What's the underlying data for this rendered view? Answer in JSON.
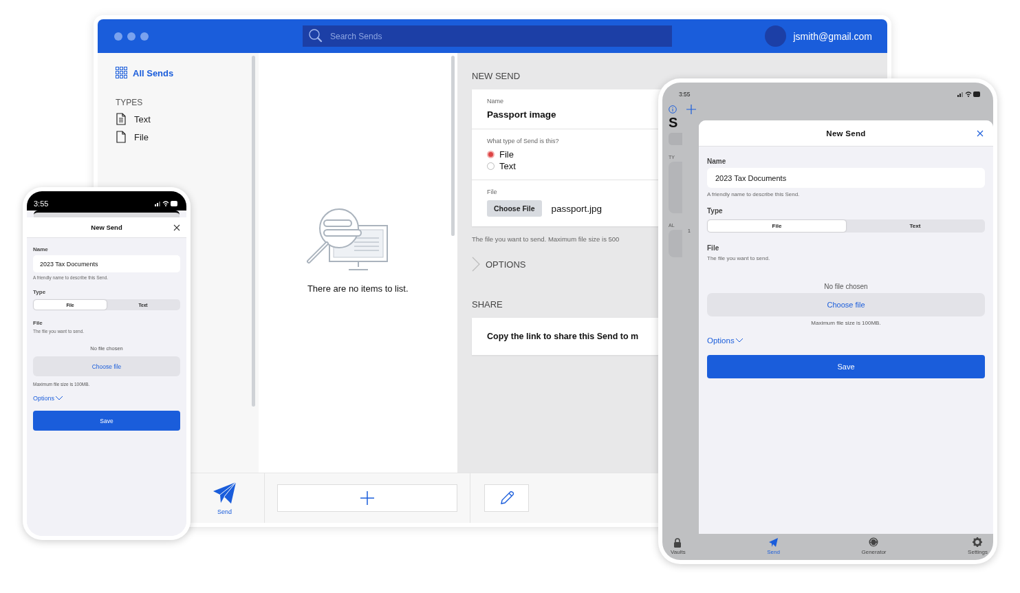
{
  "desktop": {
    "search": {
      "placeholder": "Search Sends"
    },
    "account": "jsmith@gmail.com",
    "sidebar": {
      "all_sends": {
        "label": "All Sends",
        "selected": true
      },
      "types_heading": "TYPES",
      "types": [
        {
          "label": "Text",
          "kind": "text"
        },
        {
          "label": "File",
          "kind": "file"
        }
      ],
      "nav": [
        {
          "label": "Send",
          "selected": true
        }
      ]
    },
    "list": {
      "empty_message": "There are no items to list."
    },
    "detail": {
      "heading": "NEW SEND",
      "name_label": "Name",
      "name_value": "Passport image",
      "type_question": "What type of Send is this?",
      "type_options": [
        {
          "label": "File",
          "selected": true
        },
        {
          "label": "Text",
          "selected": false
        }
      ],
      "file_label": "File",
      "choose_button": "Choose File",
      "file_name": "passport.jpg",
      "file_hint": "The file you want to send. Maximum file size is 500",
      "options_label": "OPTIONS",
      "share_heading": "SHARE",
      "share_text": "Copy the link to share this Send to m"
    }
  },
  "phone": {
    "time": "3:55",
    "title": "New Send",
    "name": {
      "label": "Name",
      "value": "2023 Tax Documents",
      "hint": "A friendly name to describe this Send."
    },
    "type": {
      "label": "Type",
      "options": [
        {
          "label": "File",
          "selected": true
        },
        {
          "label": "Text",
          "selected": false
        }
      ]
    },
    "file": {
      "label": "File",
      "hint": "The file you want to send.",
      "status": "No file chosen",
      "button": "Choose file",
      "max": "Maximum file size is 100MB."
    },
    "options_link": "Options",
    "save": "Save"
  },
  "tablet": {
    "time": "3:55",
    "background": {
      "heading": "S",
      "sections": [
        "TY",
        "AL"
      ],
      "count": "1"
    },
    "title": "New Send",
    "name": {
      "label": "Name",
      "value": "2023 Tax Documents",
      "hint": "A friendly name to describe this Send."
    },
    "type": {
      "label": "Type",
      "options": [
        {
          "label": "File",
          "selected": true
        },
        {
          "label": "Text",
          "selected": false
        }
      ]
    },
    "file": {
      "label": "File",
      "hint": "The file you want to send.",
      "status": "No file chosen",
      "button": "Choose file",
      "max": "Maximum file size is 100MB."
    },
    "options_link": "Options",
    "save": "Save",
    "tab_bar": [
      {
        "label": "Vaults",
        "kind": "lock",
        "selected": false
      },
      {
        "label": "Send",
        "kind": "send",
        "selected": true
      },
      {
        "label": "Generator",
        "kind": "generator",
        "selected": false
      },
      {
        "label": "Settings",
        "kind": "gear",
        "selected": false
      }
    ]
  }
}
